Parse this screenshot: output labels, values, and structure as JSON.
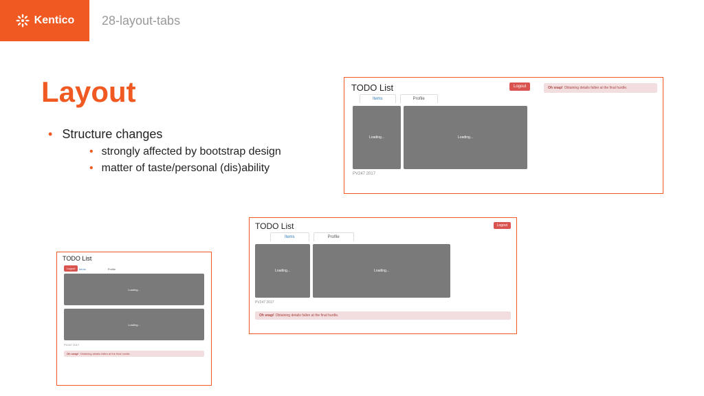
{
  "header": {
    "brand": "Kentico",
    "tab_name": "28-layout-tabs"
  },
  "title": "Layout",
  "bullets": {
    "b1": "Structure changes",
    "b2a": "strongly affected by bootstrap design",
    "b2b": "matter of taste/personal (dis)ability"
  },
  "mock": {
    "app_title": "TODO List",
    "logout": "Logout",
    "tab_items": "Items",
    "tab_profile": "Profile",
    "loading": "Loading...",
    "footer_course": "PV247",
    "footer_year": "2017",
    "alert_strong": "Oh snap!",
    "alert_text": " Obtaining details fallen at the final hurdle."
  }
}
